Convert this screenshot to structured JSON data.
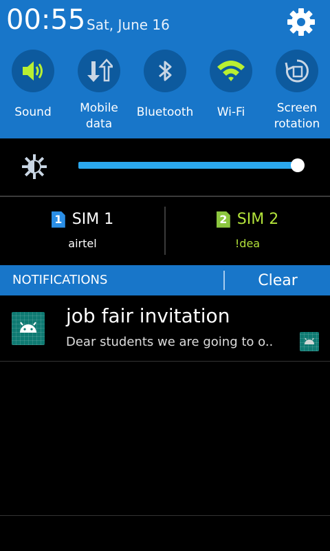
{
  "status": {
    "time": "00:55",
    "date": "Sat, June 16"
  },
  "quick_settings": [
    {
      "label": "Sound",
      "icon": "sound-icon",
      "active": true
    },
    {
      "label": "Mobile data",
      "icon": "mobile-data-icon",
      "active": false
    },
    {
      "label": "Bluetooth",
      "icon": "bluetooth-icon",
      "active": false
    },
    {
      "label": "Wi-Fi",
      "icon": "wifi-icon",
      "active": true
    },
    {
      "label": "Screen rotation",
      "icon": "screen-rotation-icon",
      "active": false
    }
  ],
  "brightness": {
    "level": 0.98
  },
  "sims": [
    {
      "badge": "1",
      "name": "SIM 1",
      "carrier": "airtel",
      "color": "#2a8ee6",
      "text_color": "#ffffff"
    },
    {
      "badge": "2",
      "name": "SIM 2",
      "carrier": "!dea",
      "color": "#8cc63f",
      "text_color": "#b3e33a"
    }
  ],
  "notifications_bar": {
    "title": "NOTIFICATIONS",
    "clear_label": "Clear"
  },
  "notification": {
    "title": "job fair invitation",
    "text": "Dear students we are going to o..",
    "app_icon": "android-icon"
  },
  "colors": {
    "accent": "#1876c9",
    "active_icon": "#b8f032",
    "slider": "#2ba8ee"
  }
}
